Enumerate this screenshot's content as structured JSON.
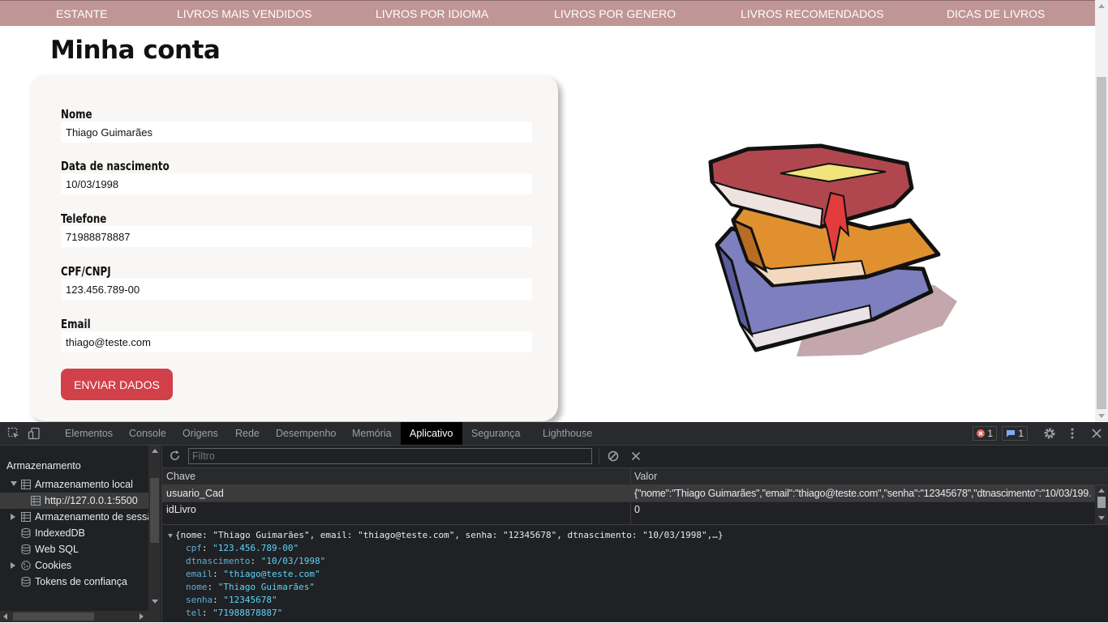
{
  "nav": [
    "ESTANTE",
    "LIVROS MAIS VENDIDOS",
    "LIVROS POR IDIOMA",
    "LIVROS POR GENERO",
    "LIVROS RECOMENDADOS",
    "DICAS DE LIVROS"
  ],
  "page": {
    "title": "Minha conta",
    "fields": [
      {
        "label": "Nome",
        "value": "Thiago Guimarães"
      },
      {
        "label": "Data de nascimento",
        "value": "10/03/1998"
      },
      {
        "label": "Telefone",
        "value": "71988878887"
      },
      {
        "label": "CPF/CNPJ",
        "value": "123.456.789-00"
      },
      {
        "label": "Email",
        "value": "thiago@teste.com"
      }
    ],
    "submit_label": "ENVIAR DADOS"
  },
  "devtools": {
    "tabs": [
      "Elementos",
      "Console",
      "Origens",
      "Rede",
      "Desempenho",
      "Memória",
      "Aplicativo",
      "Segurança",
      "Lighthouse"
    ],
    "active_tab": "Aplicativo",
    "errors_count": "1",
    "messages_count": "1",
    "sidebar": {
      "heading": "Armazenamento",
      "local_storage": "Armazenamento local",
      "local_origin": "http://127.0.0.1:5500",
      "session_storage": "Armazenamento de sessão",
      "indexeddb": "IndexedDB",
      "websql": "Web SQL",
      "cookies": "Cookies",
      "trust_tokens": "Tokens de confiança"
    },
    "filter_placeholder": "Filtro",
    "table": {
      "col_key": "Chave",
      "col_value": "Valor",
      "rows": [
        {
          "key": "usuario_Cad",
          "value": "{\"nome\":\"Thiago Guimarães\",\"email\":\"thiago@teste.com\",\"senha\":\"12345678\",\"dtnascimento\":\"10/03/199..."
        },
        {
          "key": "idLivro",
          "value": "0"
        }
      ]
    },
    "preview": {
      "summary": "{nome: \"Thiago Guimarães\", email: \"thiago@teste.com\", senha: \"12345678\", dtnascimento: \"10/03/1998\",…}",
      "props": [
        {
          "key": "cpf",
          "value": "\"123.456.789-00\""
        },
        {
          "key": "dtnascimento",
          "value": "\"10/03/1998\""
        },
        {
          "key": "email",
          "value": "\"thiago@teste.com\""
        },
        {
          "key": "nome",
          "value": "\"Thiago Guimarães\""
        },
        {
          "key": "senha",
          "value": "\"12345678\""
        },
        {
          "key": "tel",
          "value": "\"71988878887\""
        }
      ]
    }
  }
}
